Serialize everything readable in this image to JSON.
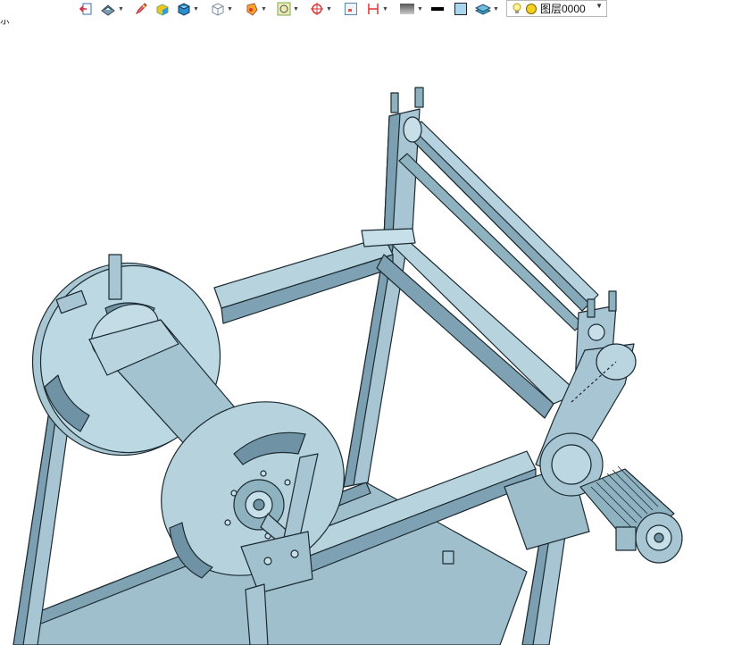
{
  "toolbar": {
    "items": [
      {
        "name": "exit-icon"
      },
      {
        "name": "view-orient-icon",
        "dropdown": true
      },
      {
        "name": "pen-icon"
      },
      {
        "name": "shaded-box-icon"
      },
      {
        "name": "solid-cube-icon",
        "dropdown": true
      },
      {
        "name": "wire-cube-icon",
        "dropdown": true
      },
      {
        "name": "render-style-icon",
        "dropdown": true
      },
      {
        "name": "frame-icon",
        "dropdown": true
      },
      {
        "name": "target-icon",
        "dropdown": true
      },
      {
        "name": "grid-icon"
      },
      {
        "name": "section-icon",
        "dropdown": true
      },
      {
        "name": "background-icon",
        "dropdown": true
      },
      {
        "name": "line-color-icon"
      },
      {
        "name": "fill-color-icon"
      },
      {
        "name": "layers-icon",
        "dropdown": true
      }
    ],
    "layer": {
      "label": "图层0000",
      "bulb_icon": "bulb-icon",
      "dot_icon": "layer-color-dot-icon"
    }
  },
  "clipped_text": "示",
  "model": {
    "name": "cable reel winder assembly",
    "colors": {
      "body": "#a7c5d2",
      "dark": "#6f93a4",
      "light": "#c7dfe8",
      "edge": "#1b2a31"
    }
  }
}
